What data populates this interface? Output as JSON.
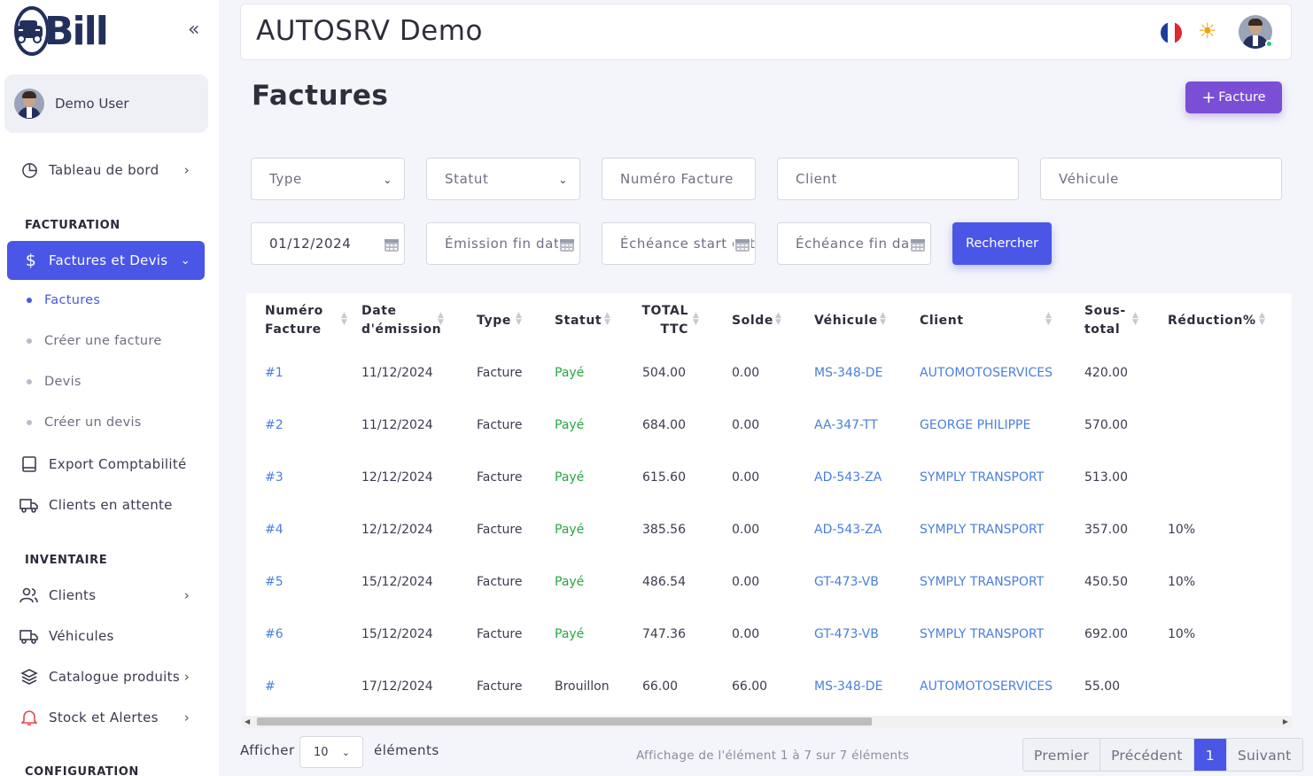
{
  "brand": {
    "logo_text": "Bill"
  },
  "user": {
    "name": "Demo User"
  },
  "sidebar": {
    "dashboard": "Tableau de bord",
    "section_billing": "FACTURATION",
    "active_group": "Factures et Devis",
    "sub_items": [
      "Factures",
      "Créer une facture",
      "Devis",
      "Créer un devis"
    ],
    "export": "Export Comptabilité",
    "waiting_clients": "Clients en attente",
    "section_inventory": "INVENTAIRE",
    "clients": "Clients",
    "vehicles": "Véhicules",
    "catalog": "Catalogue produits",
    "stock": "Stock et Alertes",
    "section_config": "CONFIGURATION"
  },
  "header": {
    "app_title": "AUTOSRV Demo",
    "language_flag": "fr",
    "theme_icon": "sun-icon"
  },
  "page": {
    "title": "Factures",
    "add_button": "Facture"
  },
  "filters": {
    "type": "Type",
    "status": "Statut",
    "invoice_number_placeholder": "Numéro Facture",
    "client_placeholder": "Client",
    "vehicle_placeholder": "Véhicule",
    "emission_start_value": "01/12/2024",
    "emission_end_placeholder": "Émission fin date",
    "due_start_placeholder": "Échéance start date",
    "due_end_placeholder": "Échéance fin date",
    "search_button": "Rechercher"
  },
  "table": {
    "columns": [
      "Numéro Facture",
      "Date d'émission",
      "Type",
      "Statut",
      "TOTAL TTC",
      "Solde",
      "Véhicule",
      "Client",
      "Sous-total",
      "Réduction%"
    ],
    "rows": [
      {
        "num": "#1",
        "date": "11/12/2024",
        "type": "Facture",
        "status": "Payé",
        "total": "504.00",
        "balance": "0.00",
        "vehicle": "MS-348-DE",
        "client": "AUTOMOTOSERVICES",
        "subtotal": "420.00",
        "discount": ""
      },
      {
        "num": "#2",
        "date": "11/12/2024",
        "type": "Facture",
        "status": "Payé",
        "total": "684.00",
        "balance": "0.00",
        "vehicle": "AA-347-TT",
        "client": "GEORGE PHILIPPE",
        "subtotal": "570.00",
        "discount": ""
      },
      {
        "num": "#3",
        "date": "12/12/2024",
        "type": "Facture",
        "status": "Payé",
        "total": "615.60",
        "balance": "0.00",
        "vehicle": "AD-543-ZA",
        "client": "SYMPLY TRANSPORT",
        "subtotal": "513.00",
        "discount": ""
      },
      {
        "num": "#4",
        "date": "12/12/2024",
        "type": "Facture",
        "status": "Payé",
        "total": "385.56",
        "balance": "0.00",
        "vehicle": "AD-543-ZA",
        "client": "SYMPLY TRANSPORT",
        "subtotal": "357.00",
        "discount": "10%"
      },
      {
        "num": "#5",
        "date": "15/12/2024",
        "type": "Facture",
        "status": "Payé",
        "total": "486.54",
        "balance": "0.00",
        "vehicle": "GT-473-VB",
        "client": "SYMPLY TRANSPORT",
        "subtotal": "450.50",
        "discount": "10%"
      },
      {
        "num": "#6",
        "date": "15/12/2024",
        "type": "Facture",
        "status": "Payé",
        "total": "747.36",
        "balance": "0.00",
        "vehicle": "GT-473-VB",
        "client": "SYMPLY TRANSPORT",
        "subtotal": "692.00",
        "discount": "10%"
      },
      {
        "num": "#",
        "date": "17/12/2024",
        "type": "Facture",
        "status": "Brouillon",
        "total": "66.00",
        "balance": "66.00",
        "vehicle": "MS-348-DE",
        "client": "AUTOMOTOSERVICES",
        "subtotal": "55.00",
        "discount": ""
      }
    ]
  },
  "footer": {
    "show_label": "Afficher",
    "page_size": "10",
    "elements_label": "éléments",
    "info": "Affichage de l'élément 1 à 7 sur 7 éléments",
    "pagination": {
      "first": "Premier",
      "prev": "Précédent",
      "current": "1",
      "next": "Suivant"
    }
  },
  "colors": {
    "primary": "#4a56e6",
    "accent_purple": "#7a4fd6",
    "link": "#4a7ee0",
    "paid": "#28a745"
  }
}
